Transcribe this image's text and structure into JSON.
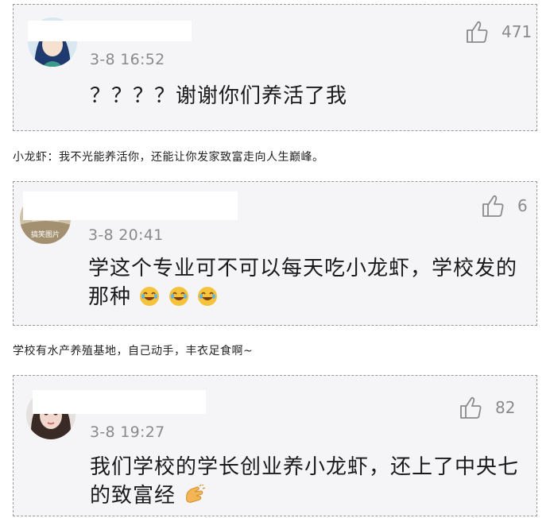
{
  "comments": [
    {
      "time": "3-8 16:52",
      "text": "？？？？谢谢你们养活了我",
      "likes": "471",
      "avatar": "anime-girl-avatar-icon"
    },
    {
      "time": "3-8 20:41",
      "text_line1": "学这个专业可不可以每天吃小龙虾，学校发的",
      "text_line2": "那种",
      "likes": "6",
      "avatar_text": "搞笑图片",
      "emoji": "laughing-tears-emoji-icon"
    },
    {
      "time": "3-8 19:27",
      "text_line1": "我们学校的学长创业养小龙虾，还上了中央七",
      "text_line2": "的致富经",
      "likes": "82",
      "emoji": "clapping-hands-emoji-icon"
    }
  ],
  "captions": [
    "小龙虾：我不光能养活你，还能让你发家致富走向人生巅峰。",
    "学校有水产养殖基地，自己动手，丰衣足食啊~"
  ]
}
